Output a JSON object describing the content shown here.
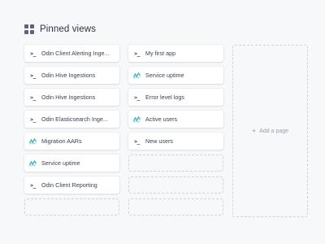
{
  "header": {
    "title": "Pinned views",
    "icon": "grid-icon"
  },
  "column_a": [
    {
      "label": "Odin Client Alerting Inge...",
      "icon": "terminal-icon"
    },
    {
      "label": "Odin Hive Ingestions",
      "icon": "terminal-icon"
    },
    {
      "label": "Odin Hive Ingestions",
      "icon": "terminal-icon"
    },
    {
      "label": "Odin Elasticsearch Inge...",
      "icon": "terminal-icon"
    },
    {
      "label": "Migration AARs",
      "icon": "chart-icon"
    },
    {
      "label": "Service uptime",
      "icon": "chart-icon"
    },
    {
      "label": "Odin Client Reporting",
      "icon": "terminal-icon"
    }
  ],
  "column_b": [
    {
      "label": "My first app",
      "icon": "terminal-icon"
    },
    {
      "label": "Service uptime",
      "icon": "chart-icon"
    },
    {
      "label": "Error level logs",
      "icon": "terminal-icon"
    },
    {
      "label": "Active users",
      "icon": "chart-icon"
    },
    {
      "label": "New users",
      "icon": "terminal-icon"
    }
  ],
  "add_page": {
    "label": "Add a page",
    "icon": "plus-icon"
  },
  "colors": {
    "background": "#f7f8fa",
    "card": "#ffffff",
    "chart_icon": "#2bb3b8",
    "dashed_border": "#cfd4dc"
  }
}
